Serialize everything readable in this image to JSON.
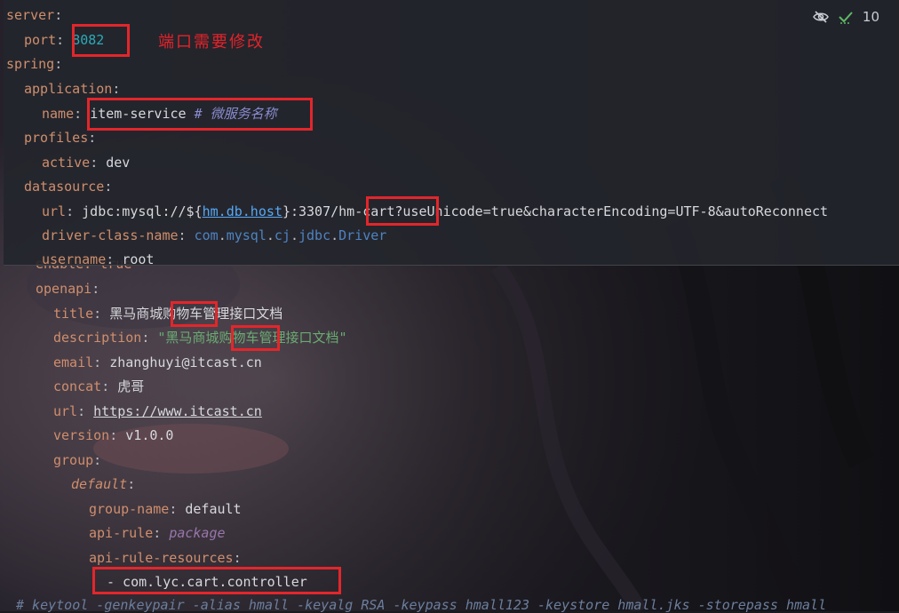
{
  "editor": {
    "inspection_count": "10",
    "icons": [
      "eye-slash-icon",
      "check-icon"
    ]
  },
  "annotation": "端口需要修改",
  "popup": {
    "lines": [
      {
        "key": "server",
        "sep": ":"
      },
      {
        "key": "port",
        "sep": ": ",
        "value": "8082"
      },
      {
        "key": "spring",
        "sep": ":"
      },
      {
        "key": "application",
        "sep": ":"
      },
      {
        "key": "name",
        "sep": ": ",
        "value": "item-service",
        "comment": "# 微服务名称"
      },
      {
        "key": "profiles",
        "sep": ":"
      },
      {
        "key": "active",
        "sep": ": ",
        "value": "dev"
      },
      {
        "key": "datasource",
        "sep": ":"
      },
      {
        "key": "url",
        "sep": ": ",
        "value_prefix": "jdbc:mysql://${",
        "ref": "hm.db.host",
        "value_mid": "}:3307/",
        "highlight": "hm-cart",
        "value_suffix": "?useUnicode=true&characterEncoding=UTF-8&autoReconnect"
      },
      {
        "key": "driver-class-name",
        "sep": ": ",
        "pkg1": "com",
        "dot": ".",
        "pkg2": "mysql",
        "pkg3": "cj",
        "pkg4": "jdbc",
        "cls": "Driver"
      },
      {
        "key": "username",
        "sep": ": ",
        "value": "root"
      }
    ]
  },
  "doc": {
    "enable_line": "enable: true",
    "openapi_key": "openapi",
    "title_key": "title",
    "title_prefix": "黑马商城",
    "title_highlight": "购物车",
    "title_suffix": "管理接口文档",
    "description_key": "description",
    "description_prefix": "\"黑马商城",
    "description_highlight": "购物车",
    "description_suffix": "管理接口文档\"",
    "email_key": "email",
    "email_value": "zhanghuyi@itcast.cn",
    "concat_key": "concat",
    "concat_value": "虎哥",
    "url_key": "url",
    "url_value": "https://www.itcast.cn",
    "version_key": "version",
    "version_value": "v1.0.0",
    "group_key": "group",
    "default_key": "default",
    "group_name_key": "group-name",
    "group_name_value": "default",
    "api_rule_key": "api-rule",
    "api_rule_value": "package",
    "api_rule_resources_key": "api-rule-resources",
    "resource_item": "- com.lyc.cart.controller"
  },
  "bottom_comment": "# keytool -genkeypair -alias hmall -keyalg RSA -keypass hmall123 -keystore hmall.jks -storepass hmall",
  "colors": {
    "highlight_box": "#e3262b",
    "key": "#cf8e6d",
    "string": "#6aab73",
    "number": "#2aacb8"
  }
}
